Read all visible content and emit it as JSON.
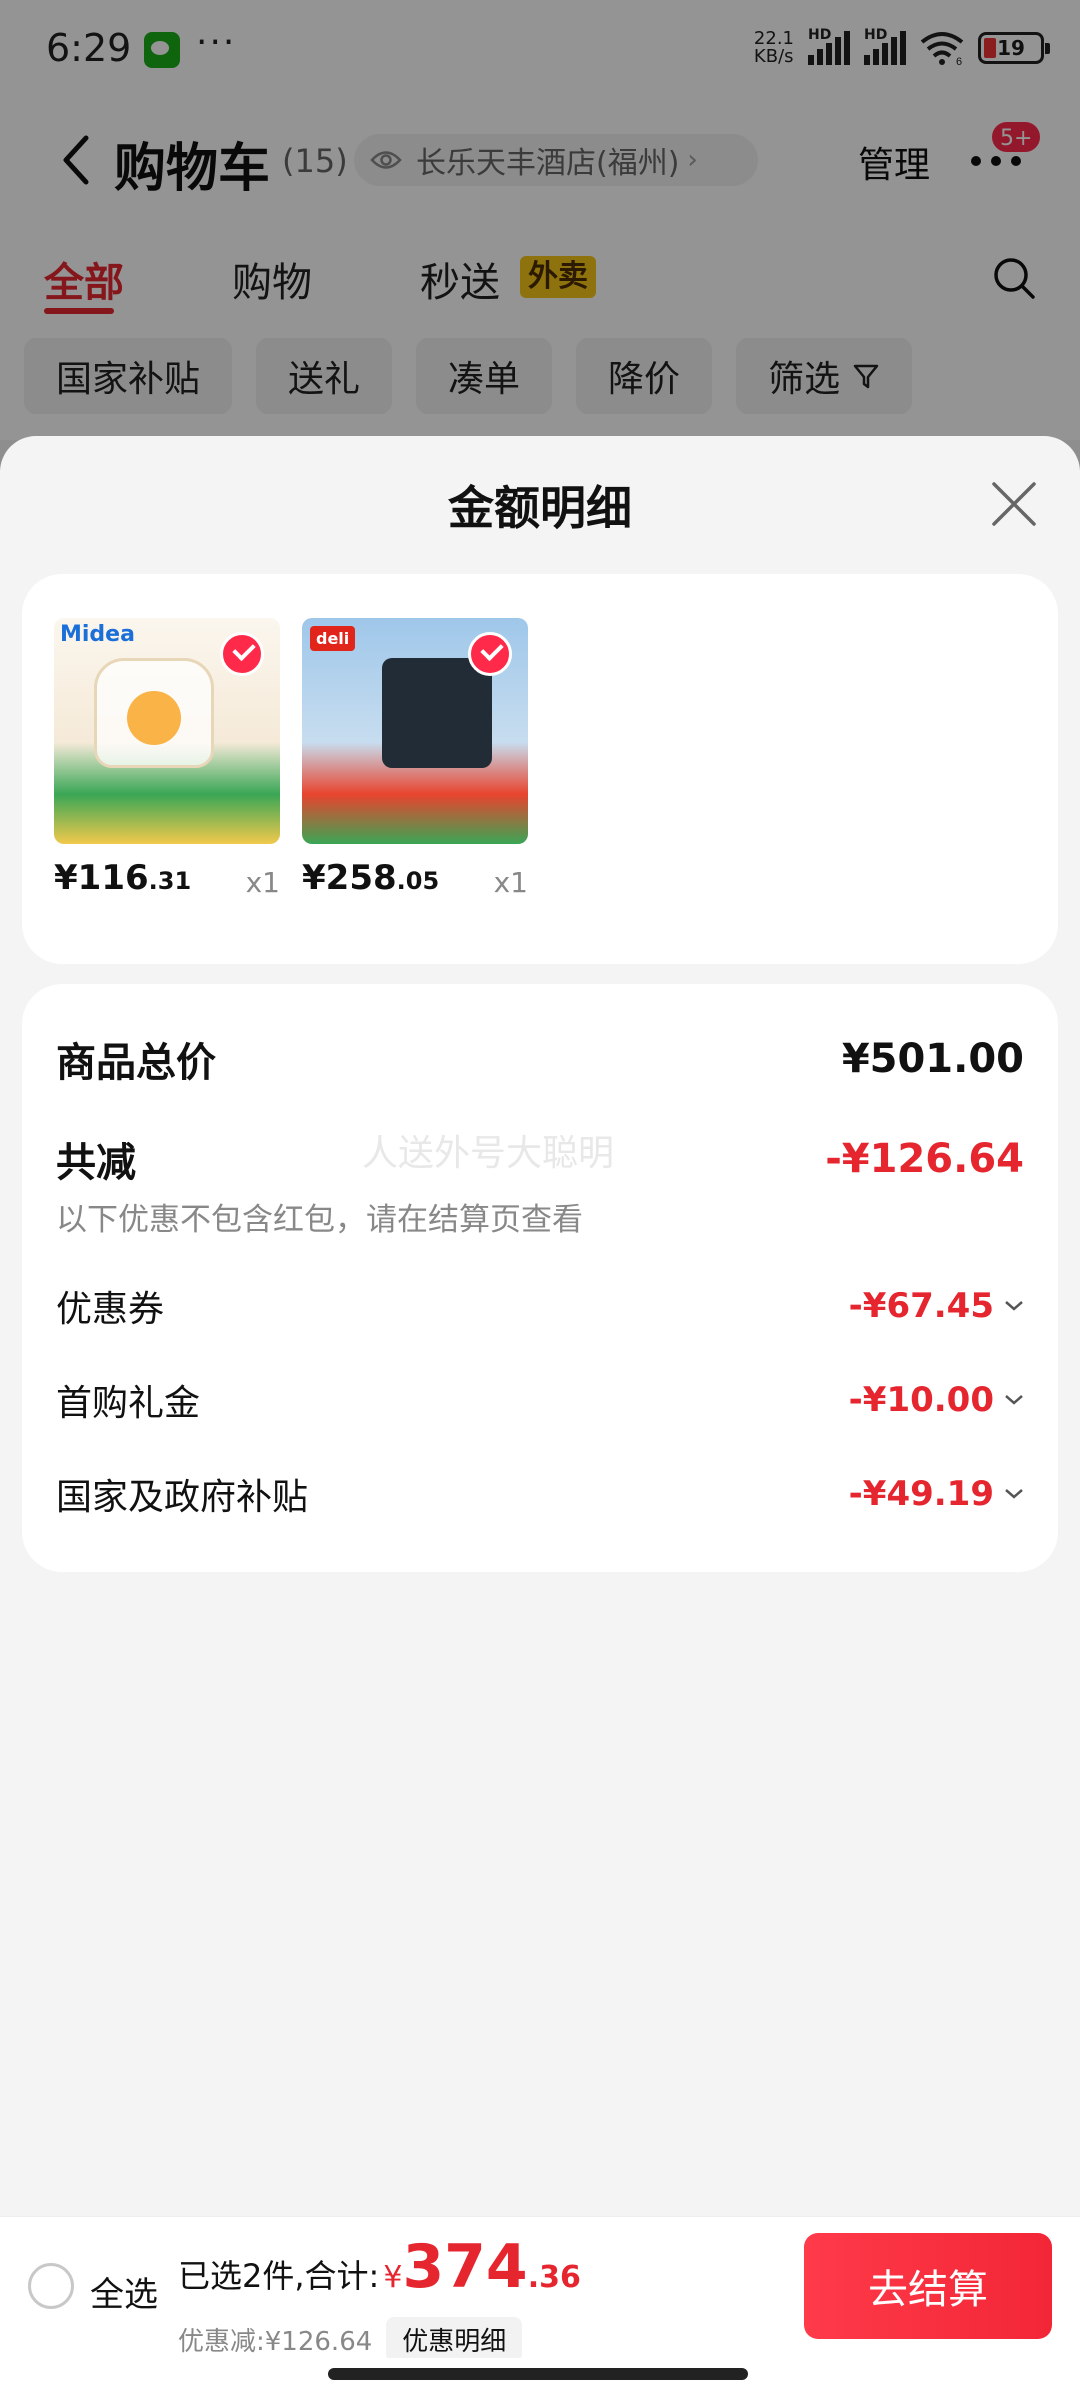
{
  "status_bar": {
    "time": "6:29",
    "more": "···",
    "net_speed_value": "22.1",
    "net_speed_unit": "KB/s",
    "hd1": "HD",
    "hd2": "HD",
    "wifi_num": "6",
    "battery": "19"
  },
  "nav": {
    "title": "购物车",
    "count": "(15)",
    "location": "长乐天丰酒店(福州)",
    "location_chevron": "›",
    "manage": "管理",
    "badge": "5+"
  },
  "tabs": [
    {
      "label": "全部"
    },
    {
      "label": "购物"
    },
    {
      "label": "秒送"
    }
  ],
  "tab_badge": "外卖",
  "chips": [
    {
      "label": "国家补贴"
    },
    {
      "label": "送礼"
    },
    {
      "label": "凑单"
    },
    {
      "label": "降价"
    },
    {
      "label": "筛选"
    }
  ],
  "sheet": {
    "title": "金额明细",
    "products": [
      {
        "brand": "Midea",
        "price_int": "¥116",
        "price_dec": ".31",
        "qty": "x1"
      },
      {
        "brand": "deli",
        "price_int": "¥258",
        "price_dec": ".05",
        "qty": "x1"
      }
    ],
    "watermark": "人送外号大聪明",
    "total_label": "商品总价",
    "total_value": "¥501.00",
    "reduce_label": "共减",
    "reduce_value": "-¥126.64",
    "note": "以下优惠不包含红包，请在结算页查看",
    "discounts": [
      {
        "label": "优惠券",
        "value": "-¥67.45"
      },
      {
        "label": "首购礼金",
        "value": "-¥10.00"
      },
      {
        "label": "国家及政府补贴",
        "value": "-¥49.19"
      }
    ]
  },
  "bottom": {
    "select_all": "全选",
    "summary_prefix": "已选",
    "selected_count": "2件,合计:",
    "currency": "¥",
    "total_int": "374",
    "total_dec": ".36",
    "discount_text": "优惠减:¥126.64",
    "detail_tag": "优惠明细",
    "checkout": "去结算"
  },
  "colors": {
    "accent": "#e6262f",
    "checkout": "#f22636",
    "badge": "#ff2a4a",
    "tab_badge": "#f5c518"
  }
}
